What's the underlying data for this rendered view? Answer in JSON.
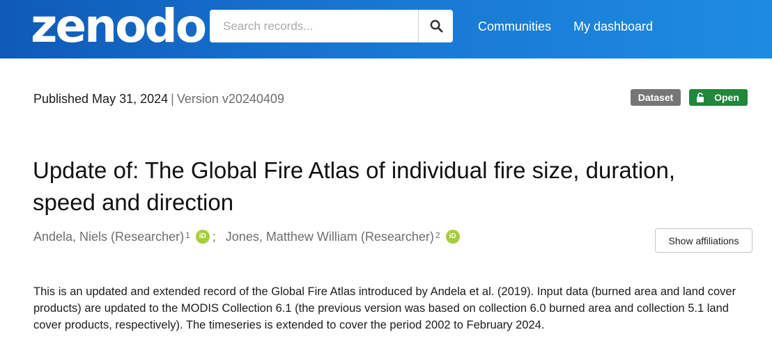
{
  "header": {
    "logo_text": "zenodo",
    "search": {
      "placeholder": "Search records...",
      "value": ""
    },
    "search_icon": "search-icon",
    "nav": [
      {
        "label": "Communities"
      },
      {
        "label": "My dashboard"
      }
    ],
    "colors": {
      "gradient_start": "#0f5ab8",
      "gradient_end": "#1e8be0"
    }
  },
  "record": {
    "published_label": "Published May 31, 2024",
    "separator": "|",
    "version_label": "Version v20240409",
    "badges": {
      "dataset": {
        "label": "Dataset",
        "color": "#767676"
      },
      "open": {
        "label": "Open",
        "icon": "unlock-icon",
        "color": "#21873b"
      }
    },
    "title": "Update of: The Global Fire Atlas of individual fire size, duration, speed and direction",
    "authors": [
      {
        "name": "Andela, Niels (Researcher)",
        "affiliation_index": "1",
        "orcid_icon": "orcid-icon"
      },
      {
        "name": "Jones, Matthew William (Researcher)",
        "affiliation_index": "2",
        "orcid_icon": "orcid-icon"
      }
    ],
    "author_separator": ";",
    "show_affiliations_label": "Show affiliations",
    "description": "This is an updated and extended record of the Global Fire Atlas introduced by Andela et al. (2019). Input data (burned area and land cover products) are updated to the MODIS Collection 6.1 (the previous version was based on collection 6.0 burned area and collection 5.1 land cover products, respectively). The timeseries is extended to cover the period 2002 to February 2024."
  }
}
